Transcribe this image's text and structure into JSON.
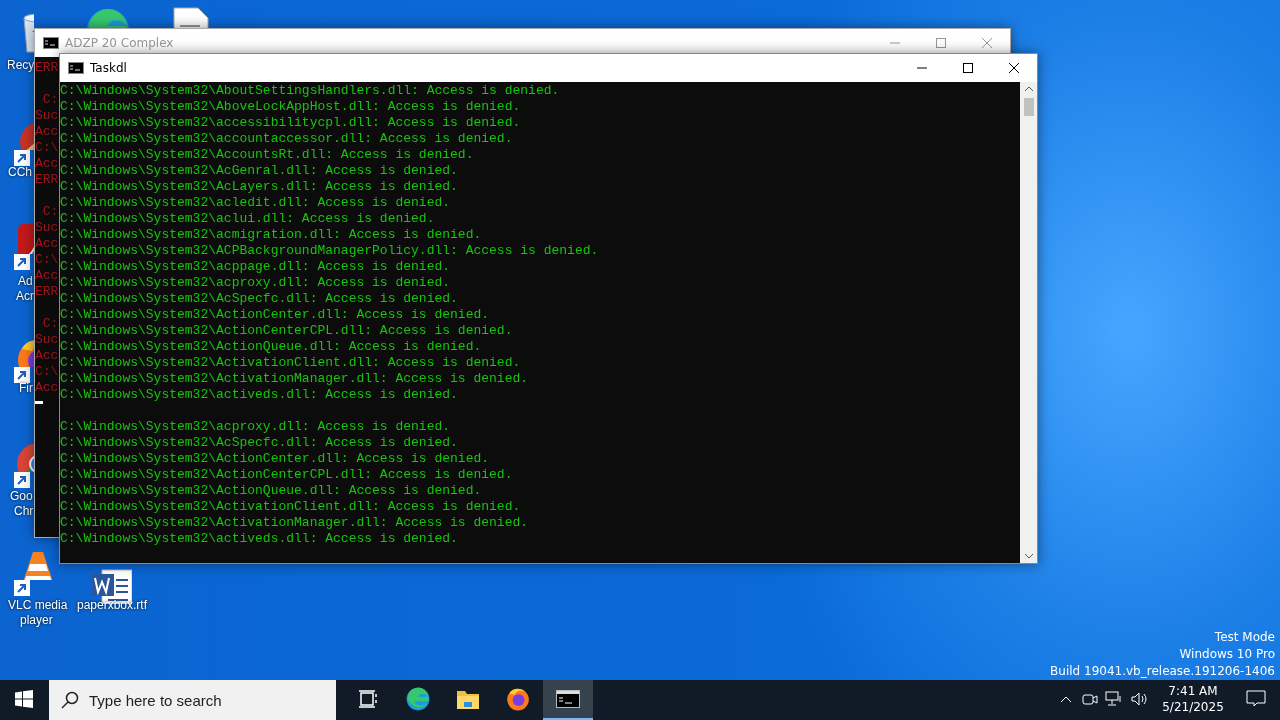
{
  "desktop_icons": [
    {
      "kind": "recycle-bin",
      "label_lines": [
        "Recy"
      ]
    },
    {
      "kind": "edge"
    },
    {
      "kind": "document"
    },
    {
      "kind": "ccleaner",
      "shortcut": true,
      "label_lines": [
        "CCh"
      ]
    },
    {
      "kind": "acrobat",
      "shortcut": true,
      "label_lines": [
        "Ad",
        "Acr"
      ]
    },
    {
      "kind": "firefox",
      "shortcut": true,
      "label_lines": [
        "Fir"
      ]
    },
    {
      "kind": "chrome",
      "shortcut": true,
      "label_lines": [
        "Goo",
        "Chr"
      ]
    },
    {
      "kind": "vlc",
      "shortcut": true,
      "label_lines": [
        "VLC media",
        "player"
      ]
    },
    {
      "kind": "word",
      "label_lines": [
        "paperxbox.rtf"
      ]
    }
  ],
  "back_window": {
    "title": "ADZP 20 Complex",
    "active": false,
    "blocks": [
      [
        "ERR"
      ],
      [
        " C:",
        "Suc",
        "Acc",
        "C:\\",
        "Acc",
        "ERR"
      ],
      [
        " C:",
        "Suc",
        "Acc",
        "C:\\",
        "Acc",
        "ERR"
      ],
      [
        " C:",
        "Suc",
        "Acc",
        "C:\\",
        "Acc"
      ]
    ]
  },
  "front_window": {
    "title": "Taskdl",
    "active": true,
    "blocks": [
      [
        "C:\\Windows\\System32\\AboutSettingsHandlers.dll: Access is denied.",
        "C:\\Windows\\System32\\AboveLockAppHost.dll: Access is denied.",
        "C:\\Windows\\System32\\accessibilitycpl.dll: Access is denied.",
        "C:\\Windows\\System32\\accountaccessor.dll: Access is denied.",
        "C:\\Windows\\System32\\AccountsRt.dll: Access is denied.",
        "C:\\Windows\\System32\\AcGenral.dll: Access is denied.",
        "C:\\Windows\\System32\\AcLayers.dll: Access is denied.",
        "C:\\Windows\\System32\\acledit.dll: Access is denied.",
        "C:\\Windows\\System32\\aclui.dll: Access is denied.",
        "C:\\Windows\\System32\\acmigration.dll: Access is denied.",
        "C:\\Windows\\System32\\ACPBackgroundManagerPolicy.dll: Access is denied.",
        "C:\\Windows\\System32\\acppage.dll: Access is denied.",
        "C:\\Windows\\System32\\acproxy.dll: Access is denied.",
        "C:\\Windows\\System32\\AcSpecfc.dll: Access is denied.",
        "C:\\Windows\\System32\\ActionCenter.dll: Access is denied.",
        "C:\\Windows\\System32\\ActionCenterCPL.dll: Access is denied.",
        "C:\\Windows\\System32\\ActionQueue.dll: Access is denied.",
        "C:\\Windows\\System32\\ActivationClient.dll: Access is denied.",
        "C:\\Windows\\System32\\ActivationManager.dll: Access is denied.",
        "C:\\Windows\\System32\\activeds.dll: Access is denied."
      ],
      [
        "C:\\Windows\\System32\\acproxy.dll: Access is denied.",
        "C:\\Windows\\System32\\AcSpecfc.dll: Access is denied.",
        "C:\\Windows\\System32\\ActionCenter.dll: Access is denied.",
        "C:\\Windows\\System32\\ActionCenterCPL.dll: Access is denied.",
        "C:\\Windows\\System32\\ActionQueue.dll: Access is denied.",
        "C:\\Windows\\System32\\ActivationClient.dll: Access is denied.",
        "C:\\Windows\\System32\\ActivationManager.dll: Access is denied.",
        "C:\\Windows\\System32\\activeds.dll: Access is denied."
      ]
    ]
  },
  "os_notice": [
    "Test Mode",
    "Windows 10 Pro",
    "Build 19041.vb_release.191206-1406"
  ],
  "taskbar": {
    "search": {
      "placeholder": "Type here to search"
    },
    "apps": [
      {
        "kind": "task-view",
        "selected": false
      },
      {
        "kind": "edge",
        "selected": false
      },
      {
        "kind": "explorer",
        "selected": false
      },
      {
        "kind": "firefox",
        "selected": false
      },
      {
        "kind": "console",
        "selected": true
      }
    ],
    "time": "7:41 AM",
    "date": "5/21/2025"
  }
}
